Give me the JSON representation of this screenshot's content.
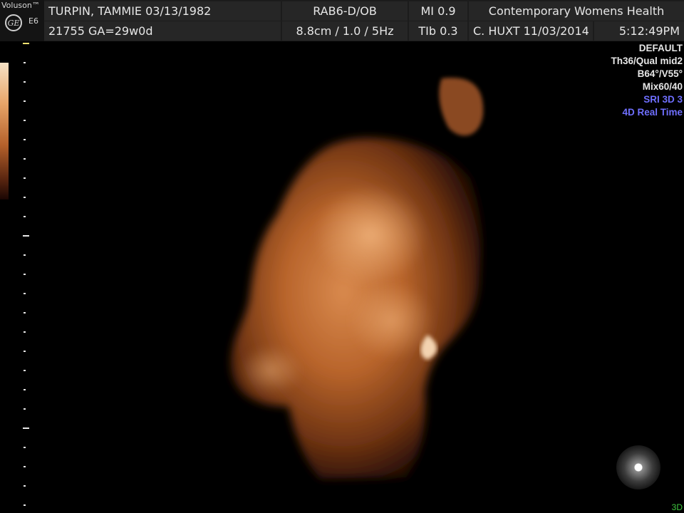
{
  "brand": {
    "name": "Voluson™",
    "logo_text": "GE",
    "model": "E6"
  },
  "header": {
    "patient_name": "TURPIN, TAMMIE  03/13/1982",
    "patient_id": "21755  GA=29w0d",
    "probe": "RAB6-D/OB",
    "depth_freq": "8.8cm / 1.0 /  5Hz",
    "mi": "MI  0.9",
    "tib": "TIb  0.3",
    "institution": "Contemporary Womens Health",
    "operator_date": "C. HUXT  11/03/2014",
    "time": "5:12:49PM"
  },
  "params": {
    "preset": "DEFAULT",
    "threshold": "Th36/Qual mid2",
    "angles": "B64°/V55°",
    "mix": "Mix60/40",
    "sri": "SRI 3D 3",
    "mode": "4D Real Time"
  },
  "mode_label": "3D",
  "colors": {
    "accent_blue": "#6f6fff",
    "mode_green": "#3fc93f",
    "render_tint": "#c06b2e"
  }
}
